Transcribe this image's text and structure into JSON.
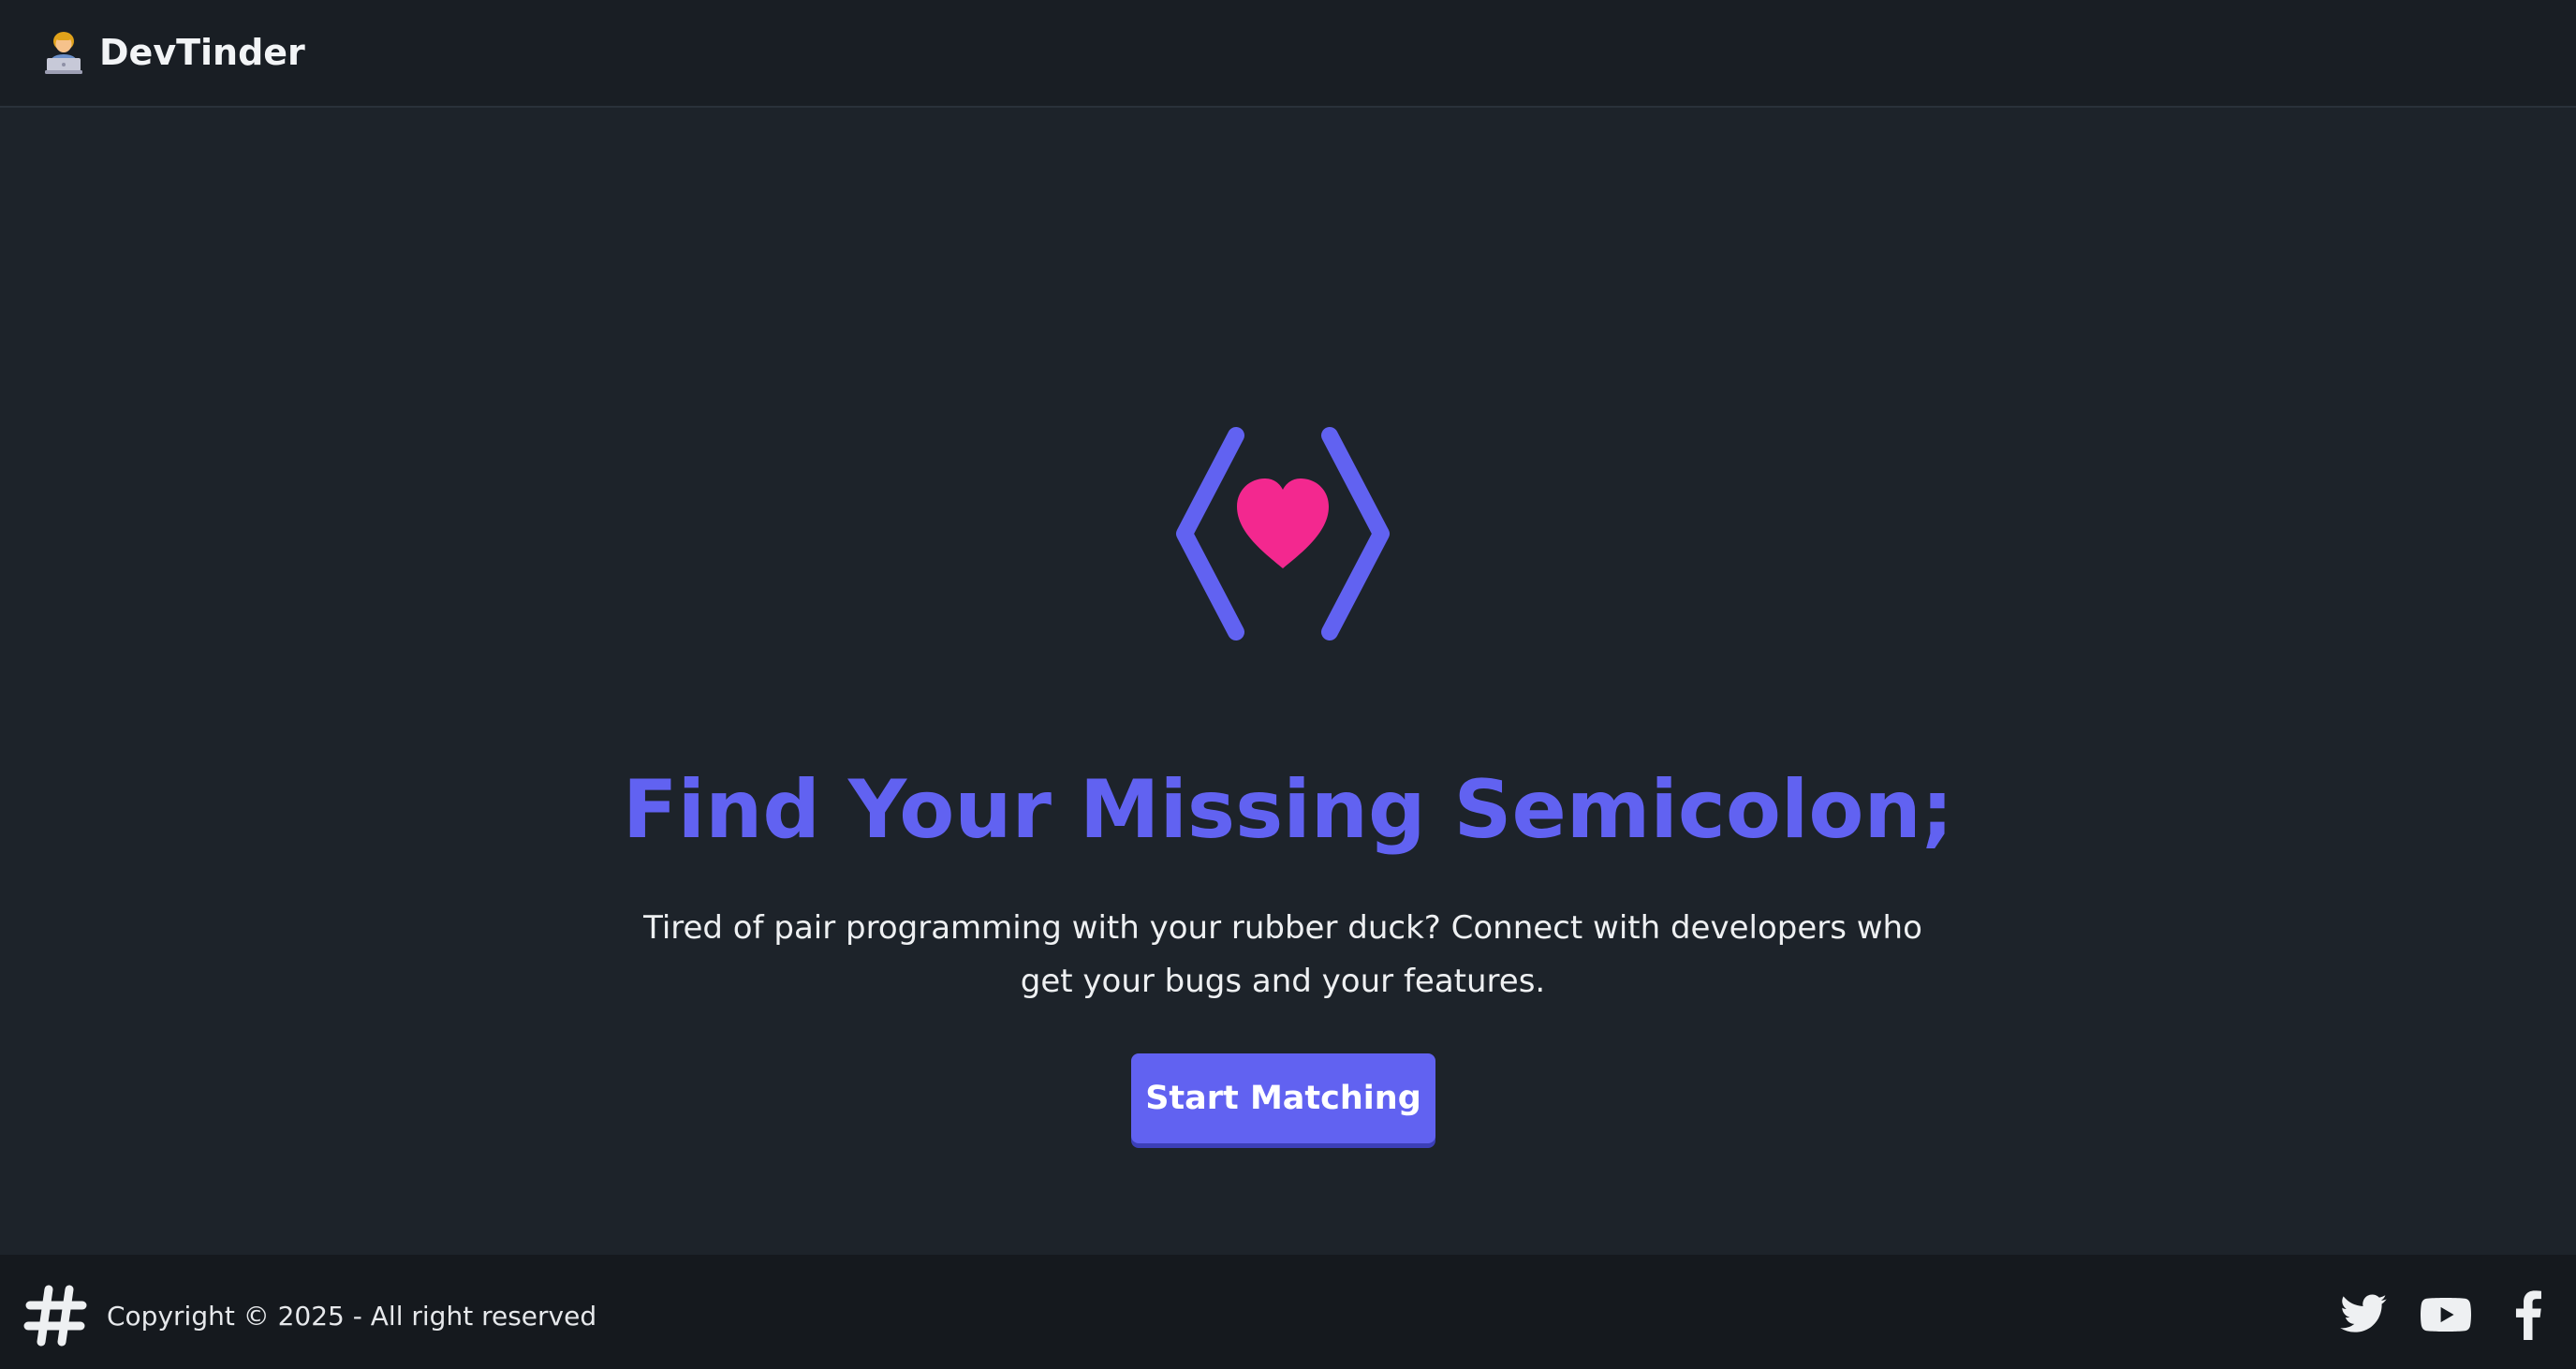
{
  "navbar": {
    "brand_name": "DevTinder",
    "brand_icon": "technologist-emoji-icon"
  },
  "hero": {
    "logo_icon": "code-brackets-heart-icon",
    "headline": "Find Your Missing Semicolon;",
    "subtext": "Tired of pair programming with your rubber duck? Connect with developers who get your bugs and your features.",
    "cta_label": "Start Matching"
  },
  "footer": {
    "logo_icon": "hash-icon",
    "copyright": "Copyright © 2025 - All right reserved",
    "socials": [
      "twitter-icon",
      "youtube-icon",
      "facebook-icon"
    ]
  },
  "colors": {
    "background": "#1d232a",
    "navbar": "#191e24",
    "footer": "#15191e",
    "accent": "#6162f1",
    "heart": "#f3288f",
    "text": "#eef0f2"
  }
}
